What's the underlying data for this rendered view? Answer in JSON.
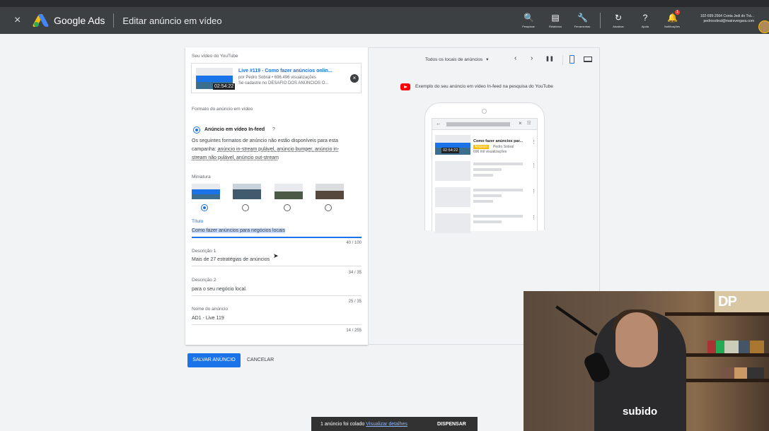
{
  "topbar": {
    "close_glyph": "×",
    "brand": "Google Ads",
    "page_title": "Editar anúncio em vídeo",
    "tools": [
      {
        "icon": "search-icon",
        "glyph": "🔍",
        "label": "Pesquisar"
      },
      {
        "icon": "reports-icon",
        "glyph": "▤",
        "label": "Relatórios"
      },
      {
        "icon": "wrench-icon",
        "glyph": "🔧",
        "label": "Ferramentas"
      },
      {
        "icon": "refresh-icon",
        "glyph": "↻",
        "label": "Atualizar"
      },
      {
        "icon": "help-icon",
        "glyph": "?",
        "label": "Ajuda"
      },
      {
        "icon": "bell-icon",
        "glyph": "🔔",
        "label": "Notificações",
        "badge": "1"
      }
    ],
    "account_line1": "102-699-2564 Conta Jedi do Trá...",
    "account_line2": "pedrosobral@mairsvergara.com"
  },
  "editor": {
    "video_label": "Seu vídeo do YouTube",
    "video": {
      "thumb_text": "ANÚNCIOS ONLINE PARA",
      "duration": "02:54:22",
      "title": "Live #119 - Como fazer anúncios onlin...",
      "byline": "por Pedro Sobral • 696.496 visualizações",
      "desc": "Se cadastre no DESAFIO DOS ANÚNCIOS O..."
    },
    "format_label": "Formato do anúncio em vídeo",
    "format_option": "Anúncio em vídeo In-feed",
    "info_glyph": "?",
    "unavailable_1": "Os seguintes formatos de anúncio não estão disponíveis para esta",
    "unavailable_2_prefix": "campanha: ",
    "unavailable_2_links": "anúncio in-stream pulável, anúncio bumper, anúncio in-",
    "unavailable_3": "stream não pulável, anúncio out-stream",
    "thumbnail_label": "Miniatura",
    "title_label": "Título",
    "title_value": "Como fazer anúncios para negócios locais",
    "title_count": "40 / 100",
    "desc1_label": "Descrição 1",
    "desc1_value": "Mais de 27 estratégias de anúncios",
    "desc1_count": "34 / 35",
    "desc2_label": "Descrição 2",
    "desc2_value": "para o seu negócio local.",
    "desc2_count": "25 / 35",
    "name_label": "Nome do anúncio",
    "name_value": "AD1 - Live 119",
    "name_count": "14 / 255"
  },
  "preview": {
    "location_select": "Todos os locais de anúncios",
    "caret": "▾",
    "prev": "‹",
    "next": "›",
    "pause": "❚❚",
    "caption": "Exemplo do seu anúncio em vídeo In-feed na pesquisa do YouTube",
    "phone": {
      "back": "←",
      "clear": "×",
      "filter": "☷",
      "ad_title": "Como fazer anúncios par...",
      "ad_badge": "Anúncio",
      "ad_channel": "Pedro Sobral",
      "ad_views": "696 mil visualizações",
      "duration": "02:54:22",
      "menu": "⋮"
    }
  },
  "actions": {
    "save": "SALVAR ANÚNCIO",
    "cancel": "CANCELAR"
  },
  "snackbar": {
    "message": "1 anúncio foi colado",
    "link": "Visualizar detalhes",
    "dismiss": "DISPENSAR"
  },
  "webcam": {
    "shirt_text": "subido",
    "sign_text": "DP"
  },
  "colors": {
    "topbar": "#3c4043",
    "accent": "#1a73e8",
    "youtube": "#ff0000",
    "snackbar": "#323232"
  }
}
